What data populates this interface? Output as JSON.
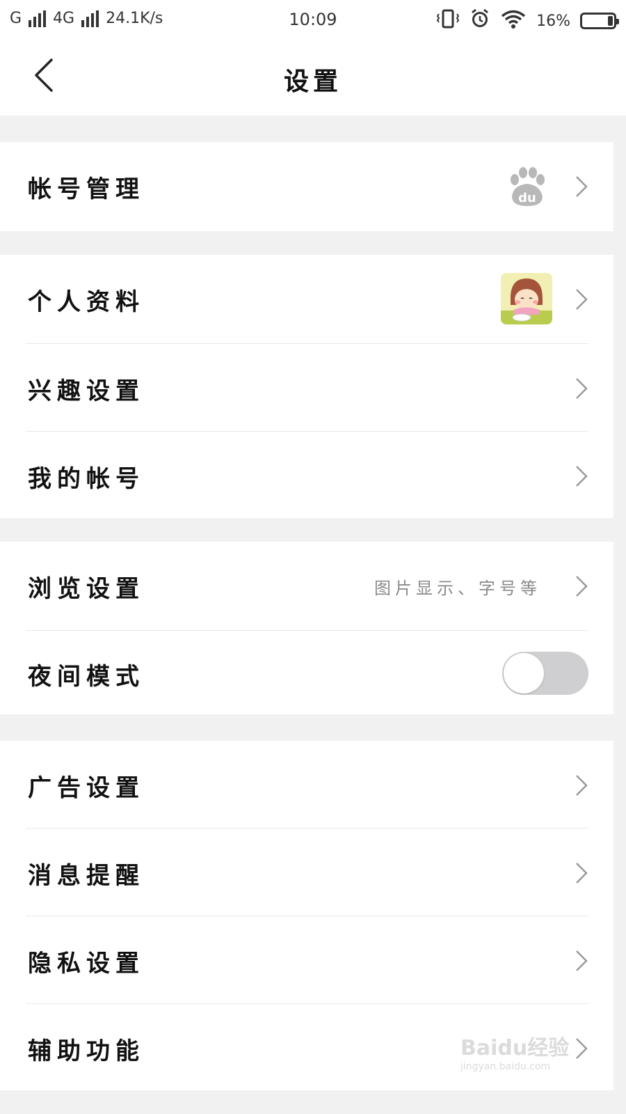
{
  "status_bar": {
    "carrier1": "G",
    "carrier2": "4G",
    "speed": "24.1K/s",
    "time": "10:09",
    "battery": "16%"
  },
  "header": {
    "title": "设置"
  },
  "groups": [
    {
      "items": [
        {
          "label": "帐号管理",
          "icon": "baidu-paw-icon"
        }
      ]
    },
    {
      "items": [
        {
          "label": "个人资料",
          "icon": "avatar"
        },
        {
          "label": "兴趣设置"
        },
        {
          "label": "我的帐号"
        }
      ]
    },
    {
      "items": [
        {
          "label": "浏览设置",
          "hint": "图片显示、字号等"
        },
        {
          "label": "夜间模式",
          "toggle_on": false
        }
      ]
    },
    {
      "items": [
        {
          "label": "广告设置"
        },
        {
          "label": "消息提醒"
        },
        {
          "label": "隐私设置"
        },
        {
          "label": "辅助功能"
        }
      ]
    }
  ],
  "watermark": {
    "logo_text": "Baidu经验",
    "url": "jingyan.baidu.com"
  }
}
